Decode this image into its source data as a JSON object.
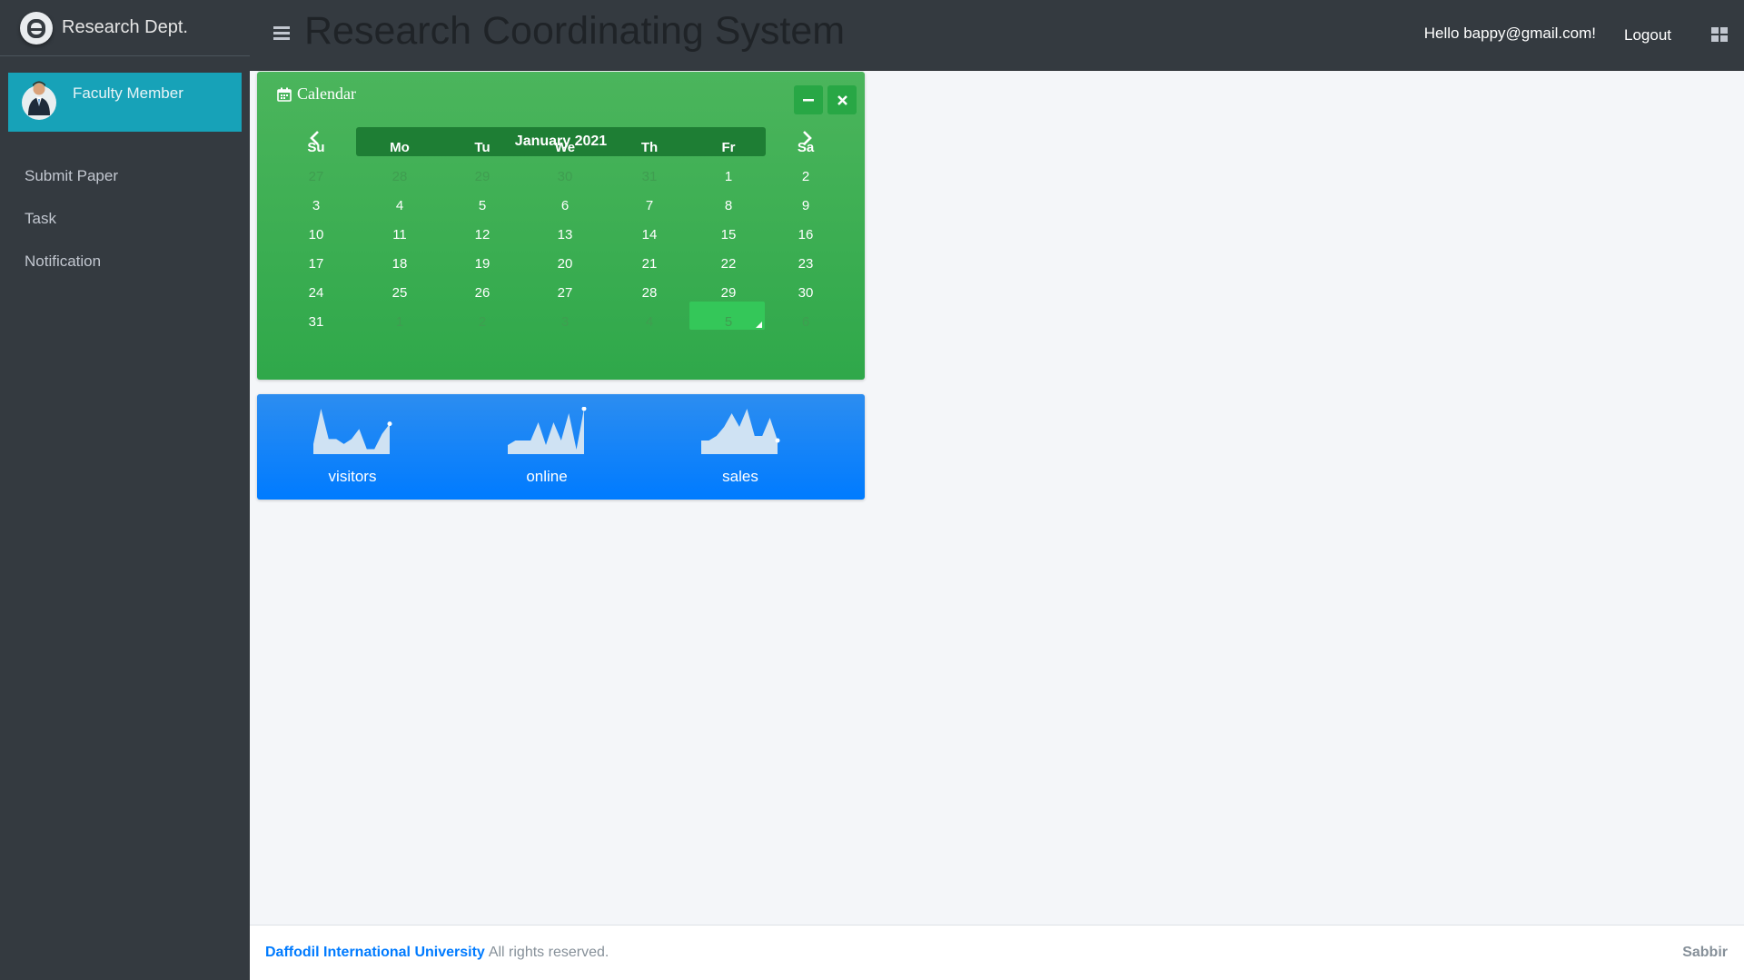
{
  "sidebar": {
    "brand": "Research Dept.",
    "user_name": "Faculty Member",
    "items": [
      {
        "label": "Submit Paper"
      },
      {
        "label": "Task"
      },
      {
        "label": "Notification"
      }
    ]
  },
  "header": {
    "title": "Research Coordinating System",
    "greeting": "Hello bappy@gmail.com!",
    "logout_label": "Logout"
  },
  "calendar": {
    "title": "Calendar",
    "month": "January 2021",
    "weekdays": [
      "Su",
      "Mo",
      "Tu",
      "We",
      "Th",
      "Fr",
      "Sa"
    ],
    "weeks": [
      [
        "27",
        "28",
        "29",
        "30",
        "31",
        "1",
        "2"
      ],
      [
        "3",
        "4",
        "5",
        "6",
        "7",
        "8",
        "9"
      ],
      [
        "10",
        "11",
        "12",
        "13",
        "14",
        "15",
        "16"
      ],
      [
        "17",
        "18",
        "19",
        "20",
        "21",
        "22",
        "23"
      ],
      [
        "24",
        "25",
        "26",
        "27",
        "28",
        "29",
        "30"
      ],
      [
        "31",
        "1",
        "2",
        "3",
        "4",
        "5",
        "6"
      ]
    ],
    "selected_day": "29",
    "icons": {
      "header": "calendar-icon",
      "minimize": "minus-icon",
      "close": "times-icon",
      "prev": "chevron-left-icon",
      "next": "chevron-right-icon"
    }
  },
  "sparklines": [
    {
      "label": "visitors",
      "values": [
        2,
        9,
        3,
        3,
        2,
        3,
        5,
        1,
        1,
        4,
        6
      ]
    },
    {
      "label": "online",
      "values": [
        2,
        3,
        3,
        3,
        7,
        2,
        7,
        3,
        9,
        1,
        10
      ]
    },
    {
      "label": "sales",
      "values": [
        3,
        3,
        4,
        6,
        9,
        6,
        10,
        4,
        4,
        8,
        3
      ]
    }
  ],
  "footer": {
    "org": "Daffodil International University",
    "rights": "All rights reserved.",
    "author": "Sabbir"
  },
  "colors": {
    "sidebar": "#343a40",
    "user_panel": "#17a2b8",
    "calendar_card": "#2fa84a",
    "sparkline_card": "#007bff",
    "link": "#007bff"
  }
}
